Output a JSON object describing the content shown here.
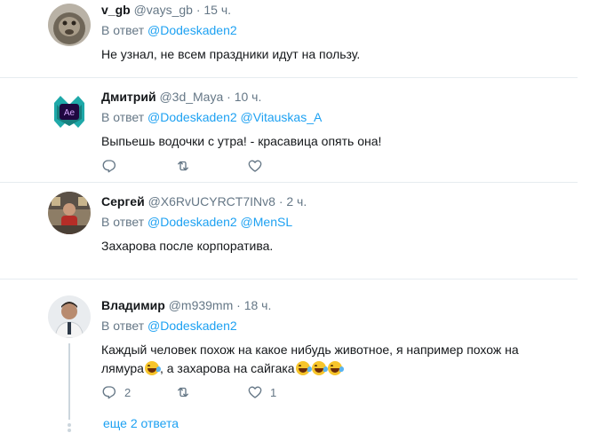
{
  "replying_to_label": "В ответ",
  "more_replies_label": "еще 2 ответа",
  "colors": {
    "link": "#1da1f2",
    "muted": "#657786",
    "divider": "#e6ecf0"
  },
  "tweets": [
    {
      "name": "v_gb",
      "handle": "@vays_gb",
      "separator": "·",
      "time": "15 ч.",
      "mentions": [
        "@Dodeskaden2"
      ],
      "text": "Не узнал, не всем праздники идут на пользу.",
      "avatar_icon": "monkey-photo"
    },
    {
      "name": "Дмитрий",
      "handle": "@3d_Maya",
      "separator": "·",
      "time": "10 ч.",
      "mentions": [
        "@Dodeskaden2",
        "@Vitauskas_A"
      ],
      "text": "Выпьешь водочки с утра! - красавица опять она!",
      "avatar_icon": "after-effects-logo",
      "avatar_text": "Ae",
      "actions": {
        "reply_icon": "reply-icon",
        "retweet_icon": "retweet-icon",
        "like_icon": "heart-icon"
      }
    },
    {
      "name": "Сергей",
      "handle": "@X6RvUCYRCT7INv8",
      "separator": "·",
      "time": "2 ч.",
      "mentions": [
        "@Dodeskaden2",
        "@MenSL"
      ],
      "text": "Захарова после корпоратива.",
      "avatar_icon": "person-photo"
    },
    {
      "name": "Владимир",
      "handle": "@m939mm",
      "separator": "·",
      "time": "18 ч.",
      "mentions": [
        "@Dodeskaden2"
      ],
      "text_before_emoji1": "Каждый человек похож на какое нибудь животное, я например похож на лямура",
      "text_between_emoji": ", а захарова на сайгака",
      "emoji_name": "rolling-on-floor-laughing-emoji",
      "avatar_icon": "person-photo",
      "actions": {
        "reply_count": "2",
        "retweet_count": "",
        "like_count": "1"
      }
    }
  ]
}
